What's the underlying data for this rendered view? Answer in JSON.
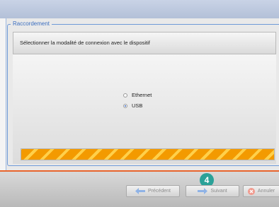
{
  "group": {
    "title": "Raccordement"
  },
  "header": {
    "instruction": "Sélectionner la modalité de connexion avec le dispositif"
  },
  "options": [
    {
      "label": "Ethernet",
      "selected": false
    },
    {
      "label": "USB",
      "selected": true
    }
  ],
  "progress": {
    "percent": 100
  },
  "buttons": {
    "previous": "Précédent",
    "next": "Suivant",
    "cancel": "Annuler"
  },
  "step_badge": "4",
  "colors": {
    "accent": "#6e9ad8",
    "progress": "#f6a400",
    "separator": "#e8642b",
    "badge": "#2aa198"
  }
}
